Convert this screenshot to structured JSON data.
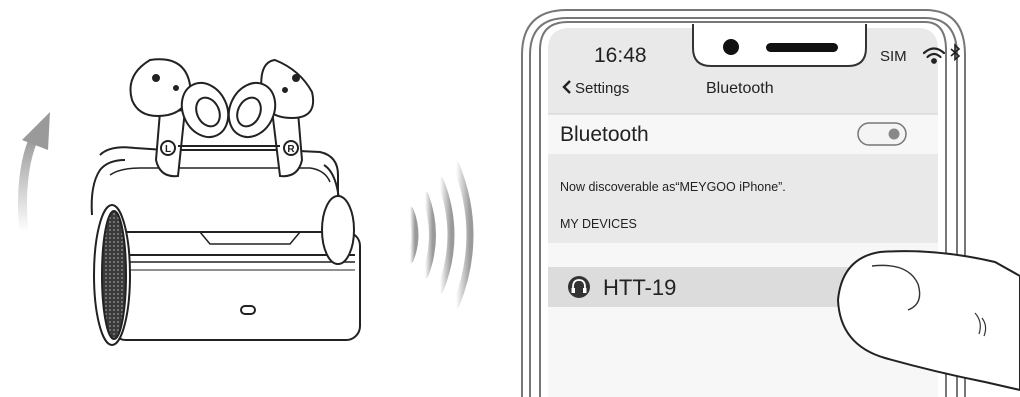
{
  "phone": {
    "status_bar": {
      "time": "16:48",
      "carrier": "SIM"
    },
    "nav": {
      "back_label": "Settings",
      "title": "Bluetooth"
    },
    "bluetooth_row": {
      "label": "Bluetooth",
      "toggle_on": true
    },
    "discoverable_text": "Now discoverable as“MEYGOO iPhone”.",
    "section_header": "MY DEVICES",
    "device": {
      "name": "HTT-19",
      "icon": "headphones-icon"
    }
  },
  "earbuds": {
    "left_mark": "L",
    "right_mark": "R"
  },
  "icons": [
    "chevron-left-icon",
    "wifi-icon",
    "bluetooth-icon",
    "headphones-icon",
    "signal-waves-icon",
    "rotate-arrow-icon"
  ],
  "colors": {
    "screen_bg": "#e9e9e9",
    "panel_bg": "#f7f7f7",
    "device_row_bg": "#dcdcdc",
    "text": "#333333",
    "line": "#555555"
  }
}
